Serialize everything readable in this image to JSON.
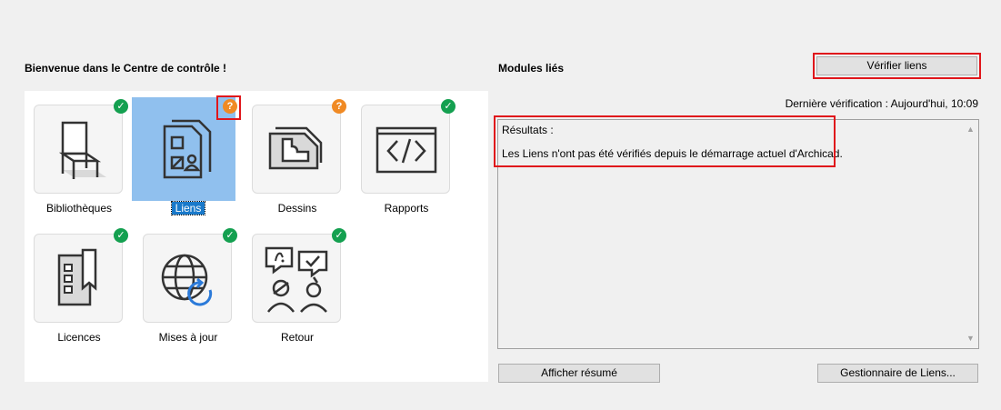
{
  "welcome_title": "Bienvenue dans le Centre de contrôle !",
  "modules": {
    "title": "Modules liés",
    "verify_button": "Vérifier liens",
    "last_check": "Dernière vérification : Aujourd'hui, 10:09",
    "results_label": "Résultats :",
    "results_message": "Les Liens n'ont pas été vérifiés depuis le démarrage actuel d'Archicad.",
    "summary_button": "Afficher résumé",
    "manager_button": "Gestionnaire de Liens..."
  },
  "tiles": [
    {
      "label": "Bibliothèques",
      "status": "ok",
      "icon": "chair-icon"
    },
    {
      "label": "Liens",
      "status": "warn",
      "icon": "linked-document-icon",
      "selected": true
    },
    {
      "label": "Dessins",
      "status": "warn",
      "icon": "drawing-icon"
    },
    {
      "label": "Rapports",
      "status": "ok",
      "icon": "code-report-icon"
    },
    {
      "label": "Licences",
      "status": "ok",
      "icon": "license-icon"
    },
    {
      "label": "Mises à jour",
      "status": "ok",
      "icon": "globe-update-icon"
    },
    {
      "label": "Retour",
      "status": "ok",
      "icon": "feedback-icon"
    }
  ],
  "badge_glyphs": {
    "ok": "✓",
    "warn": "?"
  },
  "colors": {
    "ok": "#14a050",
    "warn": "#f08a24",
    "selection": "#90c0ee",
    "highlight": "#e0161b"
  }
}
